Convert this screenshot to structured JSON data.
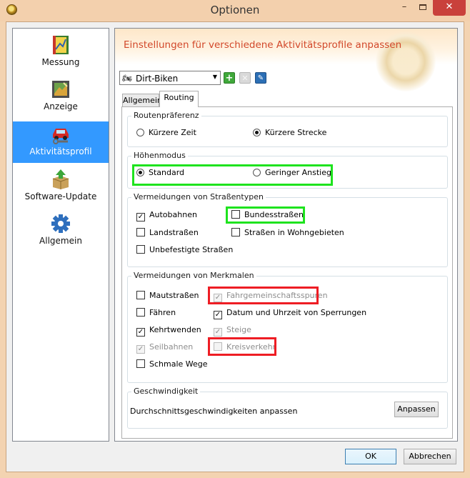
{
  "window": {
    "title": "Optionen",
    "minimize": "–",
    "close": "✕"
  },
  "nav": {
    "items": [
      {
        "label": "Messung",
        "icon": "ruler-map-icon"
      },
      {
        "label": "Anzeige",
        "icon": "display-icon"
      },
      {
        "label": "Aktivitätsprofil",
        "icon": "car-wrench-icon",
        "active": true
      },
      {
        "label": "Software-Update",
        "icon": "box-upload-icon"
      },
      {
        "label": "Allgemein",
        "icon": "gear-icon"
      }
    ]
  },
  "header": {
    "title": "Einstellungen für verschiedene Aktivitätsprofile anpassen"
  },
  "profile": {
    "selected": "Dirt-Biken",
    "add": "+",
    "delete": "✕",
    "edit": "✎"
  },
  "tabs": [
    {
      "label": "Allgemein"
    },
    {
      "label": "Routing",
      "active": true
    }
  ],
  "routing": {
    "preference": {
      "legend": "Routenpräferenz",
      "options": [
        {
          "label": "Kürzere Zeit",
          "selected": false
        },
        {
          "label": "Kürzere Strecke",
          "selected": true
        }
      ]
    },
    "elevation": {
      "legend": "Höhenmodus",
      "options": [
        {
          "label": "Standard",
          "selected": true
        },
        {
          "label": "Geringer Anstieg",
          "selected": false
        }
      ]
    },
    "road_types": {
      "legend": "Vermeidungen von Straßentypen",
      "items": [
        {
          "label": "Autobahnen",
          "checked": true
        },
        {
          "label": "Bundesstraßen",
          "checked": false
        },
        {
          "label": "Landstraßen",
          "checked": false
        },
        {
          "label": "Straßen in Wohngebieten",
          "checked": false
        },
        {
          "label": "Unbefestigte Straßen",
          "checked": false
        }
      ]
    },
    "features": {
      "legend": "Vermeidungen von Merkmalen",
      "items": [
        {
          "label": "Mautstraßen",
          "checked": false,
          "enabled": true
        },
        {
          "label": "Fahrgemeinschaftsspuren",
          "checked": true,
          "enabled": false
        },
        {
          "label": "Fähren",
          "checked": false,
          "enabled": true
        },
        {
          "label": "Datum und Uhrzeit von Sperrungen",
          "checked": true,
          "enabled": true
        },
        {
          "label": "Kehrtwenden",
          "checked": true,
          "enabled": true
        },
        {
          "label": "Steige",
          "checked": true,
          "enabled": false
        },
        {
          "label": "Seilbahnen",
          "checked": true,
          "enabled": false
        },
        {
          "label": "Kreisverkehr",
          "checked": false,
          "enabled": false
        },
        {
          "label": "Schmale Wege",
          "checked": false,
          "enabled": true
        }
      ]
    },
    "speed": {
      "legend": "Geschwindigkeit",
      "text": "Durchschnittsgeschwindigkeiten anpassen",
      "button": "Anpassen"
    }
  },
  "footer": {
    "ok": "OK",
    "cancel": "Abbrechen"
  },
  "colors": {
    "active_nav": "#3399ff",
    "header_text": "#d2482a",
    "highlight_green": "#1ee31e",
    "highlight_red": "#ee1d24",
    "close_button": "#c9413b"
  }
}
